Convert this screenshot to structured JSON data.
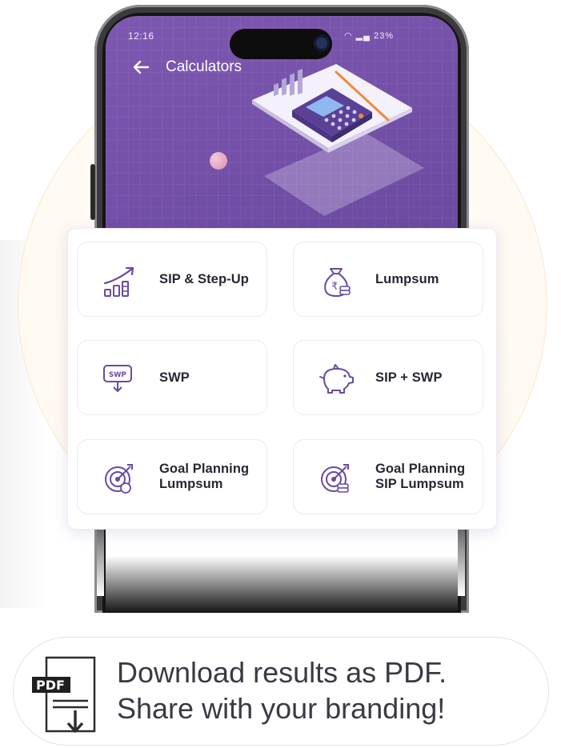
{
  "status_bar": {
    "time": "12:16",
    "battery": "23%"
  },
  "header": {
    "title": "Calculators"
  },
  "calculators": [
    {
      "label": "SIP & Step-Up",
      "icon": "growth-chart-icon"
    },
    {
      "label": "Lumpsum",
      "icon": "money-bag-icon"
    },
    {
      "label": "SWP",
      "icon": "swp-icon"
    },
    {
      "label": "SIP + SWP",
      "icon": "piggy-bank-icon"
    },
    {
      "label": "Goal Planning Lumpsum",
      "icon": "goal-target-icon"
    },
    {
      "label": "Goal Planning SIP Lumpsum",
      "icon": "goal-target-coins-icon"
    }
  ],
  "promo": {
    "badge": "PDF",
    "line1": "Download results as PDF.",
    "line2": "Share with your branding!"
  },
  "colors": {
    "accent": "#7450a8",
    "icon_purple": "#6a4aa0",
    "text": "#2b2433"
  }
}
